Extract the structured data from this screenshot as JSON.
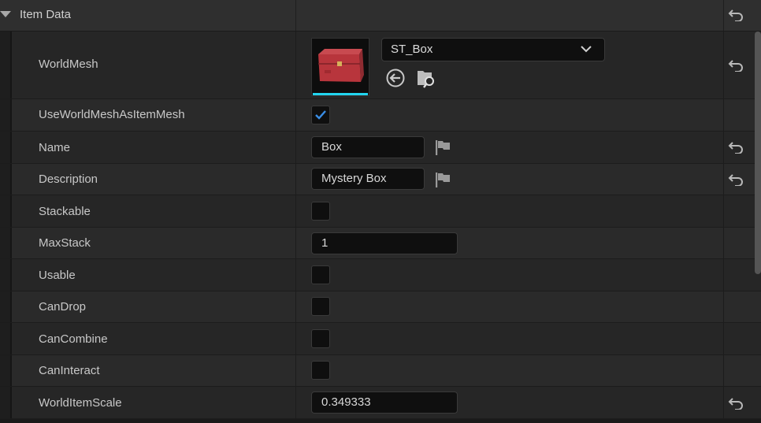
{
  "category": {
    "title": "Item Data"
  },
  "world_mesh": {
    "label": "WorldMesh",
    "asset": "ST_Box"
  },
  "properties": {
    "use_world_mesh": {
      "label": "UseWorldMeshAsItemMesh",
      "checked": true
    },
    "name": {
      "label": "Name",
      "value": "Box"
    },
    "description": {
      "label": "Description",
      "value": "Mystery Box"
    },
    "stackable": {
      "label": "Stackable",
      "checked": false
    },
    "max_stack": {
      "label": "MaxStack",
      "value": "1"
    },
    "usable": {
      "label": "Usable",
      "checked": false
    },
    "can_drop": {
      "label": "CanDrop",
      "checked": false
    },
    "can_combine": {
      "label": "CanCombine",
      "checked": false
    },
    "can_interact": {
      "label": "CanInteract",
      "checked": false
    },
    "world_item_scale": {
      "label": "WorldItemScale",
      "value": "0.349333"
    }
  },
  "icons": {
    "reset": "reset-to-default-icon",
    "flag": "localization-flag-icon",
    "use_selected": "use-selected-asset-icon",
    "browse": "browse-asset-icon",
    "dropdown": "chevron-down-icon",
    "check": "checkmark-icon"
  },
  "colors": {
    "accent": "#22d4ee",
    "check": "#3a8ee6"
  }
}
